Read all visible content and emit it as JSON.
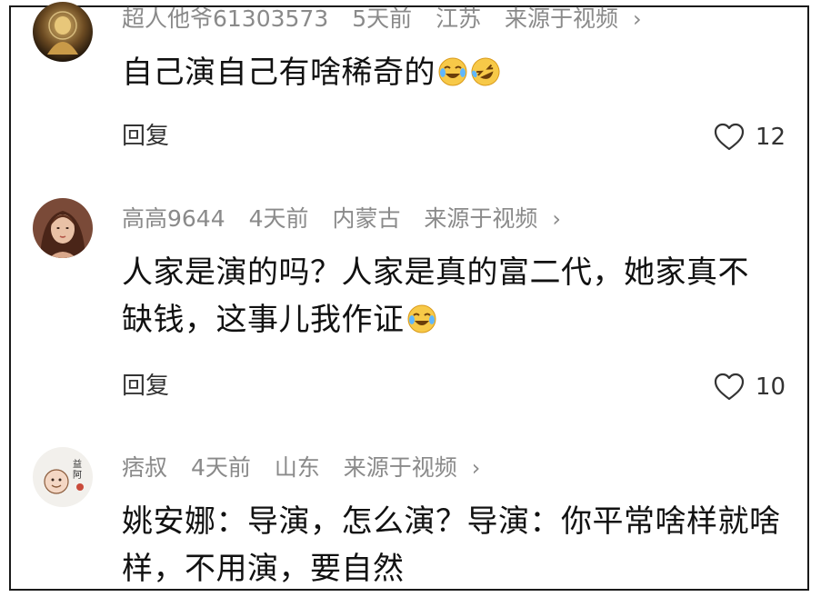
{
  "comments": [
    {
      "username": "超人他爷61303573",
      "time": "5天前",
      "location": "江苏",
      "source": "来源于视频",
      "text": "自己演自己有啥稀奇的",
      "emojis": [
        "crying-laughing-emoji",
        "rolling-laughing-emoji"
      ],
      "reply_label": "回复",
      "likes": "12"
    },
    {
      "username": "高高9644",
      "time": "4天前",
      "location": "内蒙古",
      "source": "来源于视频",
      "text": "人家是演的吗？人家是真的富二代，她家真不缺钱，这事儿我作证",
      "emojis": [
        "crying-laughing-emoji"
      ],
      "reply_label": "回复",
      "likes": "10"
    },
    {
      "username": "痞叔",
      "time": "4天前",
      "location": "山东",
      "source": "来源于视频",
      "text": "姚安娜：导演，怎么演？导演：你平常啥样就啥样，不用演，要自然",
      "emojis": []
    }
  ],
  "icons": {
    "like": "heart-outline-icon",
    "source_arrow": "chevron-right-icon"
  },
  "colors": {
    "meta_text": "#8a8a8a",
    "body_text": "#111111",
    "border": "#1a1a1a"
  }
}
